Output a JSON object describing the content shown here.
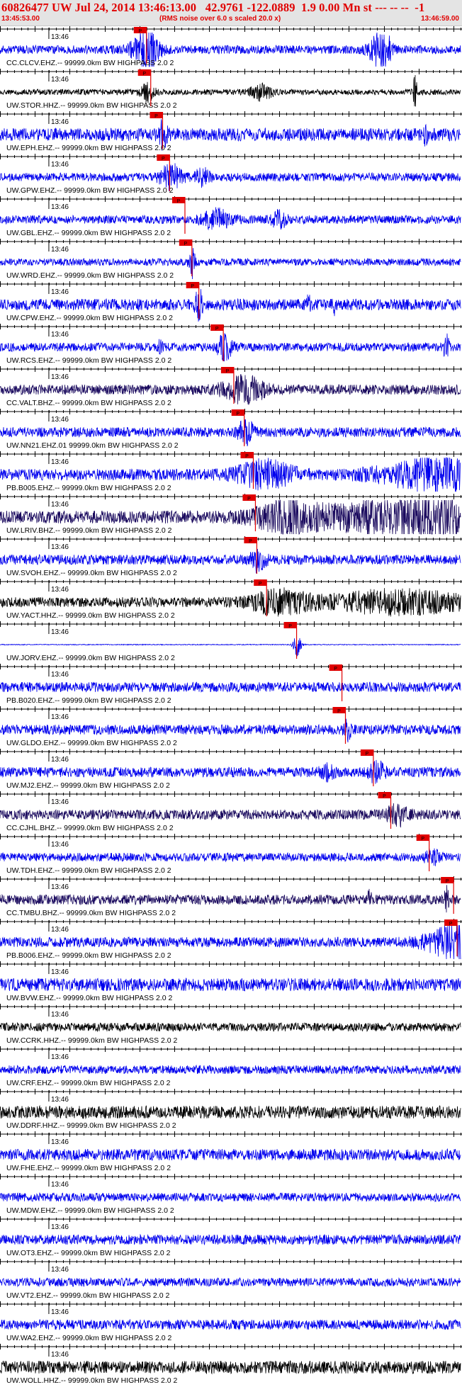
{
  "header": {
    "title": "60826477 UW Jul 24, 2014 13:46:13.00   42.9761 -122.0889  1.9 0.00 Mn st --- -- --  -1",
    "start_time": "13:45:53.00",
    "note": "(RMS noise over 6.0 s scaled 20.0 x)",
    "end_time": "13:46:59.00"
  },
  "colors": {
    "header_text": "#e00000",
    "header_bg": "#e4e4e4",
    "pick_box": "#e00000",
    "pick_line": "#e00000",
    "blue": "#0000ee",
    "black": "#000000",
    "navy": "#1a0a5e"
  },
  "chart_data": {
    "type": "seismogram",
    "time_range": [
      "13:45:53.00",
      "13:46:59.00"
    ],
    "minute_label": "13:46",
    "pick_label": "P",
    "traces": [
      {
        "label": "CC.CLCV.EHZ.-- 99999.0km BW  HIGHPASS  2.0  2",
        "color": "blue",
        "pick": "13:46:14.0",
        "amp": 0.3,
        "bursts": [
          [
            13.9,
            0.8,
            2.0
          ],
          [
            13.9,
            1.2,
            1.3
          ],
          [
            47.0,
            1.0,
            1.2
          ],
          [
            48.5,
            0.7,
            0.9
          ]
        ]
      },
      {
        "label": "UW.STOR.HHZ.-- 99999.0km BW  HIGHPASS  2.0  2",
        "color": "black",
        "pick": "13:46:14.6",
        "amp": 0.2,
        "bursts": [
          [
            14.2,
            0.6,
            1.0
          ],
          [
            30.5,
            0.5,
            1.5
          ],
          [
            52.5,
            1.3,
            0.3
          ]
        ]
      },
      {
        "label": "UW.EPH.EHZ.-- 99999.0km BW  HIGHPASS  2.0  2",
        "color": "blue",
        "pick": "13:46:16.3",
        "amp": 0.45,
        "bursts": [
          [
            16.3,
            0.8,
            0.6
          ],
          [
            54.0,
            0.8,
            0.2
          ]
        ]
      },
      {
        "label": "UW.GPW.EHZ.-- 99999.0km BW  HIGHPASS  2.0  2",
        "color": "blue",
        "pick": "13:46:17.3",
        "amp": 0.3,
        "bursts": [
          [
            17.5,
            0.8,
            1.5
          ],
          [
            22.0,
            0.5,
            1.0
          ]
        ]
      },
      {
        "label": "UW.GBL.EHZ.-- 99999.0km BW  HIGHPASS  2.0  2",
        "color": "blue",
        "pick": "13:46:19.5",
        "amp": 0.3,
        "bursts": [
          [
            24.0,
            0.6,
            2.0
          ],
          [
            33.0,
            0.5,
            1.0
          ]
        ]
      },
      {
        "label": "UW.WRD.EHZ.-- 99999.0km BW  HIGHPASS  2.0  2",
        "color": "blue",
        "pick": "13:46:20.5",
        "amp": 0.25,
        "bursts": [
          [
            20.5,
            1.3,
            0.4
          ]
        ]
      },
      {
        "label": "UW.CPW.EHZ.-- 99999.0km BW  HIGHPASS  2.0  2",
        "color": "blue",
        "pick": "13:46:21.5",
        "amp": 0.4,
        "bursts": [
          [
            21.5,
            1.0,
            0.5
          ],
          [
            37.2,
            0.7,
            0.2
          ],
          [
            41.0,
            0.7,
            0.2
          ],
          [
            60.0,
            0.5,
            0.2
          ]
        ]
      },
      {
        "label": "UW.RCS.EHZ.-- 99999.0km BW  HIGHPASS  2.0  2",
        "color": "blue",
        "pick": "13:46:25.0",
        "amp": 0.3,
        "bursts": [
          [
            16.0,
            0.5,
            0.3
          ],
          [
            25.2,
            0.8,
            1.0
          ],
          [
            57.0,
            0.7,
            0.5
          ]
        ]
      },
      {
        "label": "CC.VALT.BHZ.-- 99999.0km BW  HIGHPASS  2.0  2",
        "color": "navy",
        "pick": "13:46:26.5",
        "amp": 0.35,
        "bursts": [
          [
            28.0,
            0.8,
            3.0
          ],
          [
            63.0,
            0.6,
            3.0
          ]
        ]
      },
      {
        "label": "UW.NN21.EHZ.01 99999.0km BW  HIGHPASS  2.0  2",
        "color": "blue",
        "pick": "13:46:28.0",
        "amp": 0.35,
        "bursts": [
          [
            28.2,
            0.8,
            1.0
          ]
        ]
      },
      {
        "label": "PB.B005.EHZ.-- 99999.0km BW  HIGHPASS  2.0  2",
        "color": "blue",
        "pick": "13:46:29.3",
        "amp": 0.4,
        "bursts": [
          [
            31.0,
            0.8,
            4.0
          ],
          [
            56.0,
            1.0,
            8.0
          ]
        ]
      },
      {
        "label": "UW.LRIV.BHZ.-- 99999.0km BW  HIGHPASS  2.0  2",
        "color": "navy",
        "pick": "13:46:29.6",
        "amp": 0.45,
        "bursts": [
          [
            34.0,
            0.9,
            4.0
          ],
          [
            50.0,
            1.0,
            12.0
          ],
          [
            60.0,
            0.8,
            6.0
          ]
        ]
      },
      {
        "label": "UW.SVOH.EHZ.-- 99999.0km BW  HIGHPASS  2.0  2",
        "color": "blue",
        "pick": "13:46:29.8",
        "amp": 0.35,
        "bursts": [
          [
            30.0,
            0.7,
            1.0
          ]
        ]
      },
      {
        "label": "UW.YACT.HHZ.-- 99999.0km BW  HIGHPASS  2.0  2",
        "color": "black",
        "pick": "13:46:31.2",
        "amp": 0.35,
        "bursts": [
          [
            33.0,
            0.7,
            4.0
          ],
          [
            50.0,
            0.7,
            10.0
          ],
          [
            62.5,
            1.2,
            2.0
          ]
        ]
      },
      {
        "label": "UW.JORV.EHZ.-- 99999.0km BW  HIGHPASS  2.0  2",
        "color": "blue",
        "pick": "13:46:35.5",
        "amp": 0.03,
        "bursts": [
          [
            35.6,
            0.8,
            0.6
          ]
        ]
      },
      {
        "label": "PB.B020.EHZ.-- 99999.0km BW  HIGHPASS  2.0  2",
        "color": "blue",
        "pick": "13:46:42.0",
        "amp": 0.35,
        "bursts": []
      },
      {
        "label": "UW.GLDO.EHZ.-- 99999.0km BW  HIGHPASS  2.0  2",
        "color": "blue",
        "pick": "13:46:42.5",
        "amp": 0.35,
        "bursts": [
          [
            42.8,
            0.6,
            0.5
          ]
        ]
      },
      {
        "label": "UW.MJ2.EHZ.-- 99999.0km BW  HIGHPASS  2.0  2",
        "color": "blue",
        "pick": "13:46:46.5",
        "amp": 0.35,
        "bursts": [
          [
            47.0,
            0.7,
            1.0
          ],
          [
            40.0,
            0.4,
            1.0
          ]
        ]
      },
      {
        "label": "CC.CJHL.BHZ.-- 99999.0km BW  HIGHPASS  2.0  2",
        "color": "navy",
        "pick": "13:46:49.0",
        "amp": 0.35,
        "bursts": [
          [
            50.0,
            0.6,
            1.5
          ],
          [
            62.0,
            0.5,
            1.5
          ]
        ]
      },
      {
        "label": "UW.TDH.EHZ.-- 99999.0km BW  HIGHPASS  2.0  2",
        "color": "blue",
        "pick": "13:46:54.5",
        "amp": 0.3,
        "bursts": [
          [
            55.0,
            0.5,
            1.0
          ]
        ]
      },
      {
        "label": "CC.TMBU.BHZ.-- 99999.0km BW  HIGHPASS  2.0  2",
        "color": "navy",
        "pick": "13:46:58.0",
        "amp": 0.35,
        "bursts": [
          [
            46.0,
            0.6,
            0.3
          ],
          [
            57.0,
            0.8,
            0.3
          ],
          [
            60.0,
            0.9,
            0.3
          ]
        ]
      },
      {
        "label": "PB.B006.EHZ.-- 99999.0km BW  HIGHPASS  2.0  2",
        "color": "blue",
        "pick": "13:46:58.5",
        "amp": 0.35,
        "bursts": [
          [
            58.0,
            0.9,
            4.0
          ],
          [
            62.0,
            1.5,
            3.0
          ],
          [
            64.0,
            1.3,
            3.0
          ]
        ]
      },
      {
        "label": "UW.BVW.EHZ.-- 99999.0km BW  HIGHPASS  2.0  2",
        "color": "blue",
        "pick": null,
        "amp": 0.45,
        "bursts": []
      },
      {
        "label": "UW.CCRK.HHZ.-- 99999.0km BW  HIGHPASS  2.0  2",
        "color": "black",
        "pick": null,
        "amp": 0.3,
        "bursts": []
      },
      {
        "label": "UW.CRF.EHZ.-- 99999.0km BW  HIGHPASS  2.0  2",
        "color": "blue",
        "pick": null,
        "amp": 0.3,
        "bursts": []
      },
      {
        "label": "UW.DDRF.HHZ.-- 99999.0km BW  HIGHPASS  2.0  2",
        "color": "black",
        "pick": null,
        "amp": 0.45,
        "bursts": []
      },
      {
        "label": "UW.FHE.EHZ.-- 99999.0km BW  HIGHPASS  2.0  2",
        "color": "blue",
        "pick": null,
        "amp": 0.4,
        "bursts": []
      },
      {
        "label": "UW.MDW.EHZ.-- 99999.0km BW  HIGHPASS  2.0  2",
        "color": "blue",
        "pick": null,
        "amp": 0.3,
        "bursts": []
      },
      {
        "label": "UW.OT3.EHZ.-- 99999.0km BW  HIGHPASS  2.0  2",
        "color": "blue",
        "pick": null,
        "amp": 0.35,
        "bursts": []
      },
      {
        "label": "UW.VT2.EHZ.-- 99999.0km BW  HIGHPASS  2.0  2",
        "color": "blue",
        "pick": null,
        "amp": 0.3,
        "bursts": []
      },
      {
        "label": "UW.WA2.EHZ.-- 99999.0km BW  HIGHPASS  2.0  2",
        "color": "blue",
        "pick": null,
        "amp": 0.35,
        "bursts": []
      },
      {
        "label": "UW.WOLL.HHZ.-- 99999.0km BW  HIGHPASS  2.0  2",
        "color": "black",
        "pick": null,
        "amp": 0.45,
        "bursts": []
      }
    ]
  }
}
